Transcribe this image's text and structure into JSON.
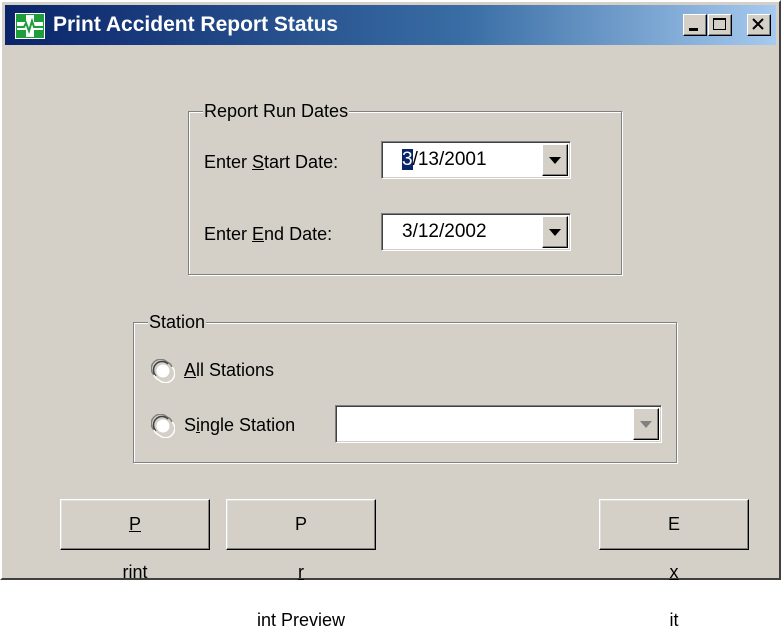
{
  "window": {
    "title": "Print Accident Report Status",
    "colors": {
      "face": "#d4d0c8",
      "title_start": "#0a246a",
      "title_end": "#a6caf0"
    }
  },
  "report_dates": {
    "legend": "Report Run Dates",
    "start": {
      "label_prefix": "Enter ",
      "label_mnemonic": "S",
      "label_rest": "tart Date:",
      "value_selected": "3",
      "value_rest": "/13/2001"
    },
    "end": {
      "label_prefix": "Enter ",
      "label_mnemonic": "E",
      "label_rest": "nd Date:",
      "value": "3/12/2002"
    }
  },
  "station": {
    "legend": "Station",
    "all": {
      "mnemonic": "A",
      "rest": "ll Stations",
      "checked": false
    },
    "single": {
      "prefix": "S",
      "mnemonic": "i",
      "rest": "ngle Station",
      "checked": false
    },
    "dropdown_value": ""
  },
  "buttons": {
    "print": {
      "mnemonic": "P",
      "rest": "rint"
    },
    "preview": {
      "prefix": "P",
      "mnemonic": "r",
      "rest": "int Preview"
    },
    "exit": {
      "prefix": "E",
      "mnemonic": "x",
      "rest": "it"
    }
  }
}
